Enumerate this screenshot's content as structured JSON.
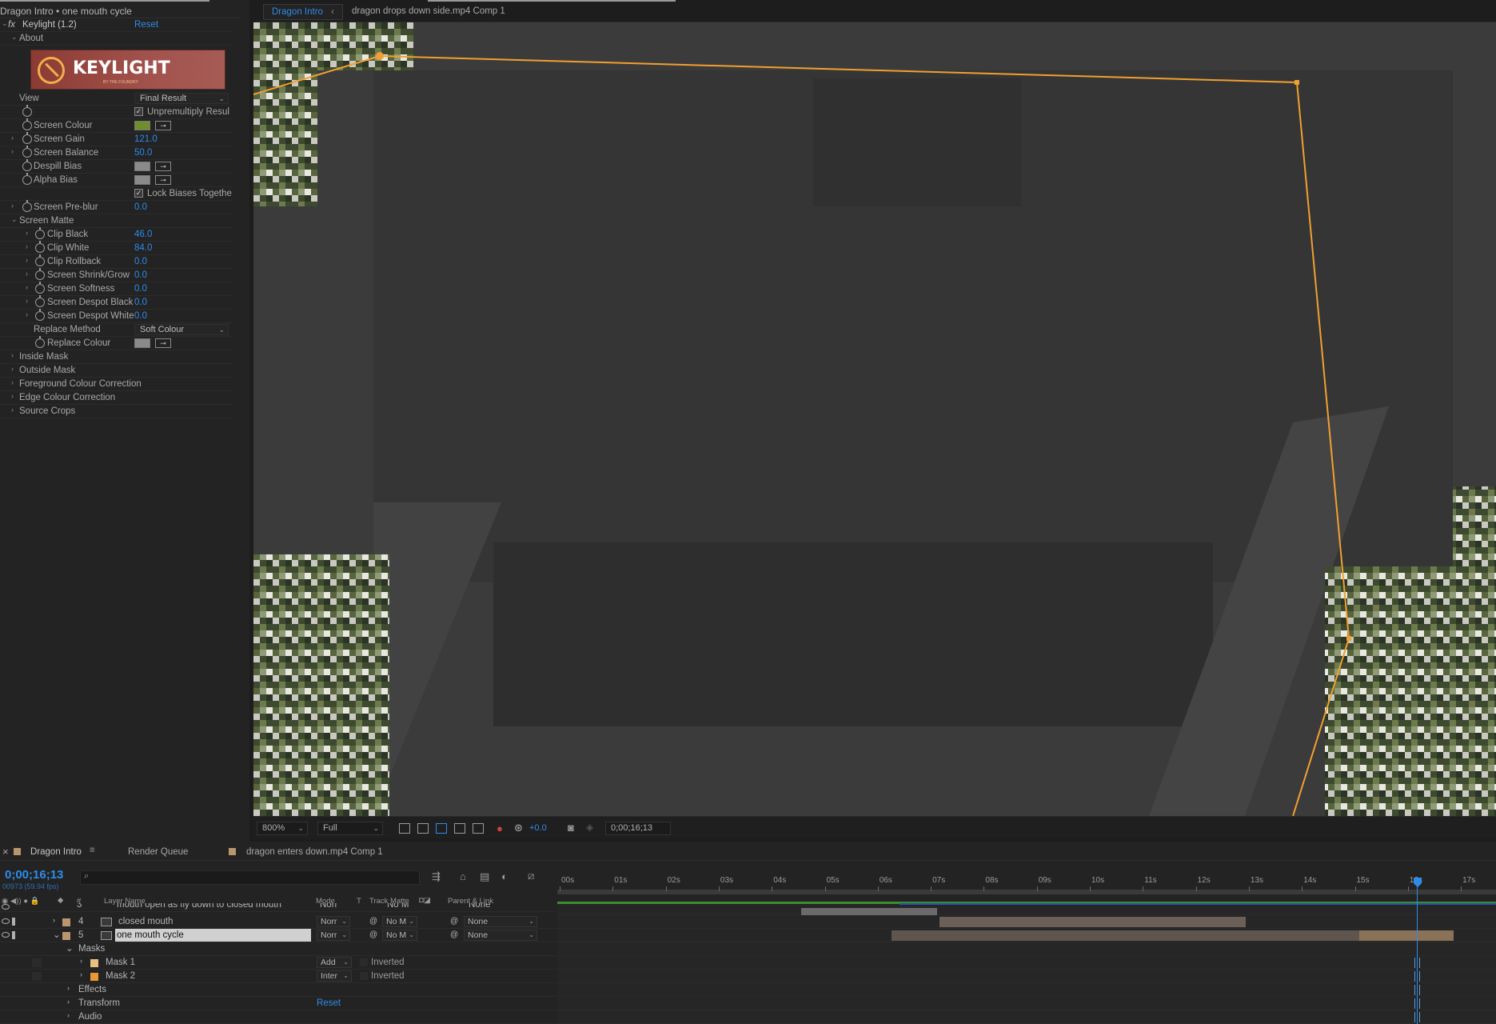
{
  "effect_controls": {
    "title": "Dragon Intro • one mouth cycle",
    "effect_name": "Keylight (1.2)",
    "reset": "Reset",
    "about": "About",
    "logo_text": "KEYLIGHT",
    "logo_sub": "BY THE FOUNDRY",
    "view_label": "View",
    "view_value": "Final Result",
    "unpremultiply": "Unpremultiply Resul",
    "screen_colour": "Screen Colour",
    "screen_colour_value": "#6f8f2f",
    "screen_gain": "Screen Gain",
    "screen_gain_value": "121.0",
    "screen_balance": "Screen Balance",
    "screen_balance_value": "50.0",
    "despill_bias": "Despill Bias",
    "alpha_bias": "Alpha Bias",
    "lock_biases": "Lock Biases Togethe",
    "screen_preblur": "Screen Pre-blur",
    "screen_preblur_value": "0.0",
    "screen_matte": "Screen Matte",
    "clip_black": "Clip Black",
    "clip_black_value": "46.0",
    "clip_white": "Clip White",
    "clip_white_value": "84.0",
    "clip_rollback": "Clip Rollback",
    "clip_rollback_value": "0.0",
    "shrink_grow": "Screen Shrink/Grow",
    "shrink_grow_value": "0.0",
    "softness": "Screen Softness",
    "softness_value": "0.0",
    "despot_black": "Screen Despot Black",
    "despot_black_value": "0.0",
    "despot_white": "Screen Despot White",
    "despot_white_value": "0.0",
    "replace_method": "Replace Method",
    "replace_method_value": "Soft Colour",
    "replace_colour": "Replace Colour",
    "inside_mask": "Inside Mask",
    "outside_mask": "Outside Mask",
    "fg_correction": "Foreground Colour Correction",
    "edge_correction": "Edge Colour Correction",
    "source_crops": "Source Crops"
  },
  "viewer": {
    "tab_active": "Dragon Intro",
    "tab_other": "dragon drops down side.mp4 Comp 1",
    "zoom": "800%",
    "resolution": "Full",
    "exposure": "+0.0",
    "timecode": "0;00;16;13"
  },
  "timeline": {
    "tab_comp": "Dragon Intro",
    "tab_render": "Render Queue",
    "tab_other": "dragon enters down.mp4 Comp 1",
    "timecode": "0;00;16;13",
    "fps": "00973 (59.94 fps)",
    "col_layer_name": "Layer Name",
    "col_mode": "Mode",
    "col_t": "T",
    "col_track_matte": "Track Matte",
    "col_parent": "Parent & Link",
    "col_num": "#",
    "ticks": [
      "00s",
      "01s",
      "02s",
      "03s",
      "04s",
      "05s",
      "06s",
      "07s",
      "08s",
      "09s",
      "10s",
      "11s",
      "12s",
      "13s",
      "14s",
      "15s",
      "16s",
      "17s"
    ],
    "layers": [
      {
        "num": "3",
        "name": "mouth open as fly down to closed mouth",
        "mode": "Norr",
        "matte": "No M",
        "parent": "None",
        "color": "#b89670"
      },
      {
        "num": "4",
        "name": "closed mouth",
        "mode": "Norr",
        "matte": "No M",
        "parent": "None",
        "color": "#b89670"
      },
      {
        "num": "5",
        "name": "one mouth cycle",
        "mode": "Norr",
        "matte": "No M",
        "parent": "None",
        "color": "#b89670"
      }
    ],
    "masks_label": "Masks",
    "mask1": "Mask 1",
    "mask1_mode": "Add",
    "mask1_inverted": "Inverted",
    "mask1_color": "#e8c080",
    "mask2": "Mask 2",
    "mask2_mode": "Inter",
    "mask2_inverted": "Inverted",
    "mask2_color": "#e89a30",
    "effects": "Effects",
    "transform": "Transform",
    "transform_reset": "Reset",
    "audio": "Audio"
  },
  "colors": {
    "accent_blue": "#2d8ceb",
    "mask_path": "#f0a030"
  }
}
